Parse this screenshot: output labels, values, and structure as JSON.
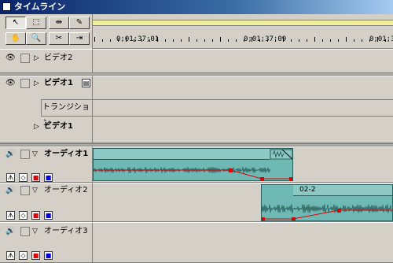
{
  "window": {
    "title": "タイムライン"
  },
  "ruler": {
    "labels": [
      "0;01;37;01",
      "0;01;37;09",
      "0;01;37;17"
    ]
  },
  "tools": [
    {
      "name": "selection-tool",
      "glyph": "↖"
    },
    {
      "name": "range-select-tool",
      "glyph": "⬚"
    },
    {
      "name": "track-select-tool",
      "glyph": "⇹"
    },
    {
      "name": "pen-tool",
      "glyph": "✎"
    },
    {
      "name": "hand-tool",
      "glyph": "✋"
    },
    {
      "name": "zoom-tool",
      "glyph": "🔍"
    },
    {
      "name": "razor-tool",
      "glyph": "✂"
    },
    {
      "name": "in-out-tool",
      "glyph": "⇥"
    }
  ],
  "tracks": {
    "video2": {
      "label": "ビデオ2"
    },
    "video1": {
      "label": "ビデオ1"
    },
    "transition": {
      "label": "トランジション"
    },
    "video1b": {
      "label": "ビデオ1"
    },
    "audio1": {
      "label": "オーディオ1"
    },
    "audio2": {
      "label": "オーディオ2"
    },
    "audio3": {
      "label": "オーディオ3"
    }
  },
  "clips": {
    "audio2_clip": {
      "label": "02-2"
    }
  },
  "colors": {
    "clip": "#6fb9b4",
    "workarea": "#f2ef9a",
    "handle": "#e00000",
    "titlebar": "#0a246a"
  }
}
